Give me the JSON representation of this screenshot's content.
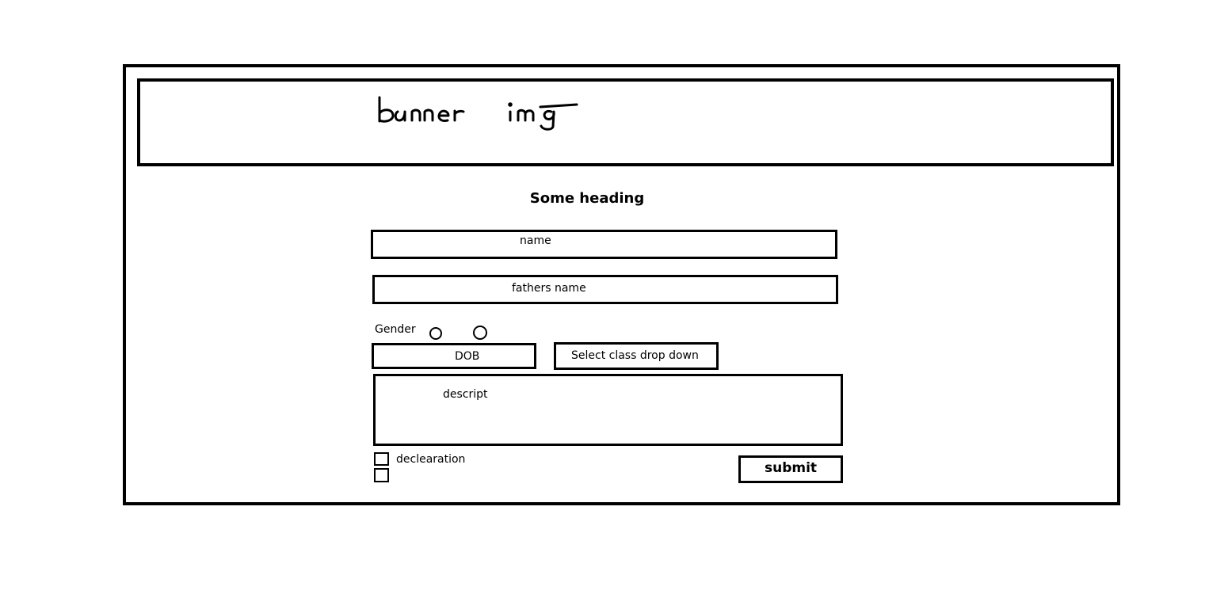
{
  "banner": {
    "label": "banner img"
  },
  "form": {
    "heading": "Some heading",
    "name_label": "name",
    "fathers_name_label": "fathers name",
    "gender_label": "Gender",
    "dob_label": "DOB",
    "class_select_label": "Select class drop down",
    "description_label": "descript",
    "declaration_label": "declearation",
    "submit_label": "submit"
  }
}
